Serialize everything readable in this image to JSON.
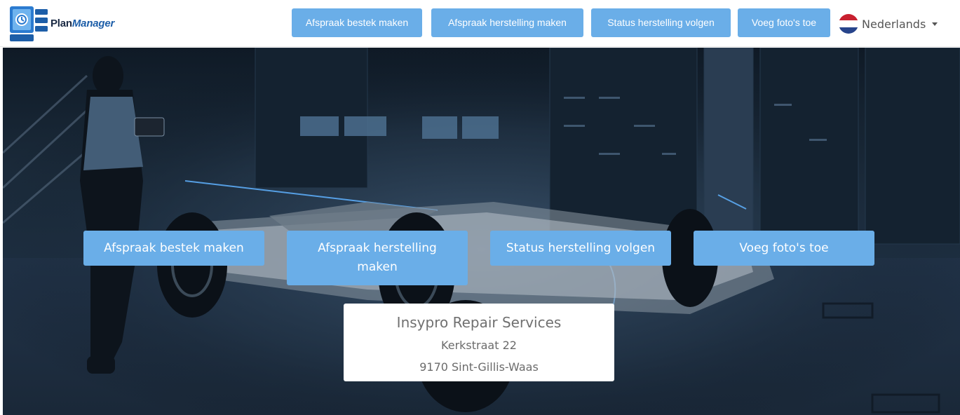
{
  "brand": {
    "name_part1": "Plan",
    "name_part2": "Manager",
    "logo_icon": "planmanager-logo-icon"
  },
  "colors": {
    "accent": "#6aaee8",
    "brand_dark": "#1b2a44",
    "brand_blue": "#1d5ea8"
  },
  "nav": {
    "buttons": [
      {
        "label": "Afspraak bestek maken"
      },
      {
        "label": "Afspraak herstelling maken"
      },
      {
        "label": "Status herstelling volgen"
      },
      {
        "label": "Voeg foto's toe"
      }
    ],
    "language": {
      "label": "Nederlands",
      "flag_icon": "netherlands-flag-icon"
    }
  },
  "hero": {
    "buttons": [
      {
        "label": "Afspraak bestek maken"
      },
      {
        "label": "Afspraak herstelling maken"
      },
      {
        "label": "Status herstelling volgen"
      },
      {
        "label": "Voeg foto's toe"
      }
    ]
  },
  "address": {
    "company": "Insypro Repair Services",
    "street": "Kerkstraat 22",
    "city": "9170 Sint-Gillis-Waas"
  }
}
